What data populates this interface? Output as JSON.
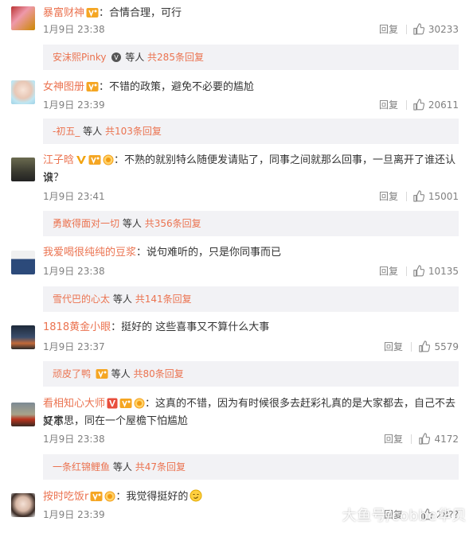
{
  "comments": [
    {
      "username": "暴富财神",
      "text": "：合情合理，可行",
      "time": "1月9日 23:38",
      "reply_label": "回复",
      "likes": "30233",
      "sub_user": "安沫熙Pinky",
      "sub_suffix": "等人",
      "sub_count": "共285条回复"
    },
    {
      "username": "女神图册",
      "text": "：不错的政策，避免不必要的尴尬",
      "time": "1月9日 23:39",
      "reply_label": "回复",
      "likes": "20611",
      "sub_user": "-初五_",
      "sub_suffix": "等人",
      "sub_count": "共103条回复"
    },
    {
      "username": "江子晗",
      "text": "：不熟的就别特么随便发请贴了，同事之间就那么回事，一旦离开了谁还认识",
      "text2": "谁？",
      "time": "1月9日 23:41",
      "reply_label": "回复",
      "likes": "15001",
      "sub_user": "勇敢得面对一切",
      "sub_suffix": "等人",
      "sub_count": "共356条回复"
    },
    {
      "username": "我爱喝很纯纯的豆浆",
      "text": "：说句难听的，只是你同事而已",
      "time": "1月9日 23:38",
      "reply_label": "回复",
      "likes": "10135",
      "sub_user": "雪代巴的心太",
      "sub_suffix": "等人",
      "sub_count": "共141条回复"
    },
    {
      "username": "1818黄金小眼",
      "text": "：挺好的 这些喜事又不算什么大事",
      "time": "1月9日 23:37",
      "reply_label": "回复",
      "likes": "5579",
      "sub_user": "顽皮了鸭",
      "sub_suffix": "等人",
      "sub_count": "共80条回复"
    },
    {
      "username": "看相知心大师",
      "text": "：这真的不错，因为有时候很多去赶彩礼真的是大家都去，自己不去又不",
      "text2": "好意思，同在一个屋檐下怕尴尬",
      "time": "1月9日 23:38",
      "reply_label": "回复",
      "likes": "4172",
      "sub_user": "一条红锦鲤鱼",
      "sub_suffix": "等人",
      "sub_count": "共47条回复"
    },
    {
      "username": "按时吃饭r",
      "text": "：我觉得挺好的",
      "time": "1月9日 23:39",
      "reply_label": "回复",
      "likes": "28??"
    }
  ],
  "watermark": "大鱼号/cobbe华贝",
  "colors": {
    "username": "#eb7350",
    "meta": "#808080",
    "subbox_bg": "#f2f2f5"
  }
}
